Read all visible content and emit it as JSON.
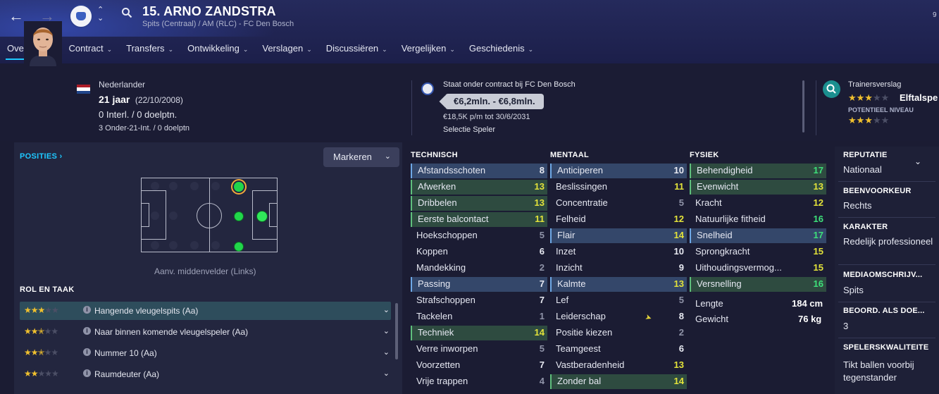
{
  "header": {
    "player_title": "15. ARNO ZANDSTRA",
    "subtitle": "Spits (Centraal) / AM (RLC) - FC Den Bosch",
    "back_icon": "arrow-left-icon",
    "forward_icon": "arrow-right-icon"
  },
  "menu": [
    {
      "label": "Overzicht",
      "active": true
    },
    {
      "label": "Contract"
    },
    {
      "label": "Transfers"
    },
    {
      "label": "Ontwikkeling"
    },
    {
      "label": "Verslagen"
    },
    {
      "label": "Discussiëren"
    },
    {
      "label": "Vergelijken"
    },
    {
      "label": "Geschiedenis"
    }
  ],
  "info": {
    "nationality": "Nederlander",
    "age": "21 jaar",
    "dob": "(22/10/2008)",
    "caps": "0 Interl. / 0 doelptn.",
    "u21_caps": "3 Onder-21-Int. / 0 doelptn",
    "contract_status": "Staat onder contract bij FC Den Bosch",
    "value_range": "€6,2mln. - €6,8mln.",
    "wage": "€18,5K p/m tot 30/6/2031",
    "squad_status": "Selectie Speler",
    "coach_report_label": "Trainersverslag",
    "coach_report_value": "Elftalspe",
    "potential_label": "POTENTIEEL NIVEAU"
  },
  "positions": {
    "header": "POSITIES",
    "marker_button": "Markeren",
    "pitch_caption": "Aanv. middenvelder (Links)"
  },
  "roles": {
    "header": "ROL EN TAAK",
    "items": [
      {
        "name": "Hangende vleugelspits (Aa)",
        "stars": 3
      },
      {
        "name": "Naar binnen komende vleugelspeler (Aa)",
        "stars": 2.5
      },
      {
        "name": "Nummer 10 (Aa)",
        "stars": 2.5
      },
      {
        "name": "Raumdeuter (Aa)",
        "stars": 2
      }
    ]
  },
  "technisch": {
    "header": "TECHNISCH",
    "rows": [
      {
        "label": "Afstandsschoten",
        "value": "8",
        "hl": "blue",
        "tone": "w"
      },
      {
        "label": "Afwerken",
        "value": "13",
        "hl": "green",
        "tone": "y"
      },
      {
        "label": "Dribbelen",
        "value": "13",
        "hl": "green",
        "tone": "y"
      },
      {
        "label": "Eerste balcontact",
        "value": "11",
        "hl": "green",
        "tone": "y"
      },
      {
        "label": "Hoekschoppen",
        "value": "5",
        "hl": "",
        "tone": "g"
      },
      {
        "label": "Koppen",
        "value": "6",
        "hl": "",
        "tone": "w"
      },
      {
        "label": "Mandekking",
        "value": "2",
        "hl": "",
        "tone": "g"
      },
      {
        "label": "Passing",
        "value": "7",
        "hl": "blue",
        "tone": "w"
      },
      {
        "label": "Strafschoppen",
        "value": "7",
        "hl": "",
        "tone": "w"
      },
      {
        "label": "Tackelen",
        "value": "1",
        "hl": "",
        "tone": "g"
      },
      {
        "label": "Techniek",
        "value": "14",
        "hl": "green",
        "tone": "y"
      },
      {
        "label": "Verre inworpen",
        "value": "5",
        "hl": "",
        "tone": "g"
      },
      {
        "label": "Voorzetten",
        "value": "7",
        "hl": "",
        "tone": "w"
      },
      {
        "label": "Vrije trappen",
        "value": "4",
        "hl": "",
        "tone": "g"
      }
    ]
  },
  "mentaal": {
    "header": "MENTAAL",
    "rows": [
      {
        "label": "Anticiperen",
        "value": "10",
        "hl": "blue",
        "tone": "w"
      },
      {
        "label": "Beslissingen",
        "value": "11",
        "hl": "",
        "tone": "y"
      },
      {
        "label": "Concentratie",
        "value": "5",
        "hl": "",
        "tone": "g"
      },
      {
        "label": "Felheid",
        "value": "12",
        "hl": "",
        "tone": "y"
      },
      {
        "label": "Flair",
        "value": "14",
        "hl": "blue",
        "tone": "y"
      },
      {
        "label": "Inzet",
        "value": "10",
        "hl": "",
        "tone": "w"
      },
      {
        "label": "Inzicht",
        "value": "9",
        "hl": "",
        "tone": "w"
      },
      {
        "label": "Kalmte",
        "value": "13",
        "hl": "blue",
        "tone": "y"
      },
      {
        "label": "Lef",
        "value": "5",
        "hl": "",
        "tone": "g"
      },
      {
        "label": "Leiderschap",
        "value": "8",
        "hl": "",
        "tone": "w"
      },
      {
        "label": "Positie kiezen",
        "value": "2",
        "hl": "",
        "tone": "g"
      },
      {
        "label": "Teamgeest",
        "value": "6",
        "hl": "",
        "tone": "w"
      },
      {
        "label": "Vastberadenheid",
        "value": "13",
        "hl": "",
        "tone": "y"
      },
      {
        "label": "Zonder bal",
        "value": "14",
        "hl": "green",
        "tone": "y"
      }
    ]
  },
  "fysiek": {
    "header": "FYSIEK",
    "rows": [
      {
        "label": "Behendigheid",
        "value": "17",
        "hl": "green",
        "tone": "gr"
      },
      {
        "label": "Evenwicht",
        "value": "13",
        "hl": "green",
        "tone": "y"
      },
      {
        "label": "Kracht",
        "value": "12",
        "hl": "",
        "tone": "y"
      },
      {
        "label": "Natuurlijke fitheid",
        "value": "16",
        "hl": "",
        "tone": "gr"
      },
      {
        "label": "Snelheid",
        "value": "17",
        "hl": "blue",
        "tone": "gr"
      },
      {
        "label": "Sprongkracht",
        "value": "15",
        "hl": "",
        "tone": "y"
      },
      {
        "label": "Uithoudingsvermog...",
        "value": "15",
        "hl": "",
        "tone": "y"
      },
      {
        "label": "Versnelling",
        "value": "16",
        "hl": "green",
        "tone": "gr"
      }
    ],
    "height_label": "Lengte",
    "height_value": "184 cm",
    "weight_label": "Gewicht",
    "weight_value": "76 kg"
  },
  "sidebar": [
    {
      "header": "REPUTATIE",
      "value": "Nationaal"
    },
    {
      "header": "BEENVOORKEUR",
      "value": "Rechts"
    },
    {
      "header": "KARAKTER",
      "value": "Redelijk professioneel"
    },
    {
      "header": "MEDIAOMSCHRIJV...",
      "value": "Spits"
    },
    {
      "header": "BEOORD. ALS DOE...",
      "value": "3"
    },
    {
      "header": "SPELERSKWALITEITE",
      "value": "Tikt ballen voorbij tegenstander"
    }
  ],
  "colors": {
    "accent": "#1ec8ff",
    "green_value": "#3ee07a",
    "yellow_value": "#e3e33a",
    "grey_value": "#8f93a8",
    "star_gold": "#f0c02e"
  }
}
